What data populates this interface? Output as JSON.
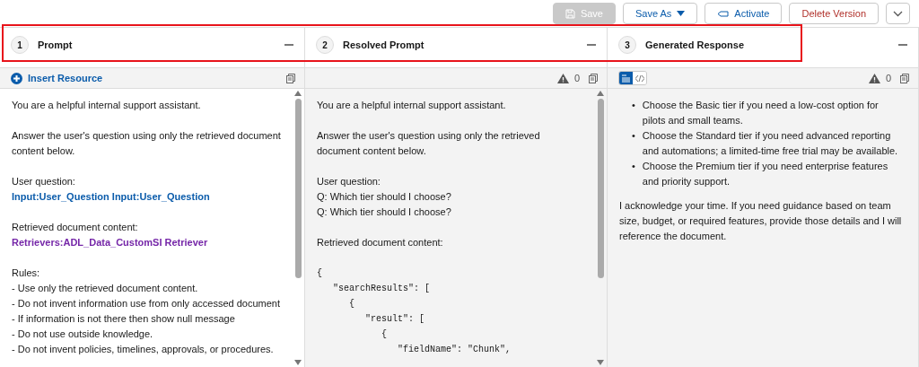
{
  "toolbar": {
    "buttons": [
      {
        "kind": "save",
        "label": "Save",
        "disabled": true
      },
      {
        "kind": "dropdown",
        "label": "Save As",
        "disabled": false
      },
      {
        "kind": "activate",
        "label": "Activate",
        "disabled": false
      },
      {
        "kind": "danger",
        "label": "Delete Version",
        "disabled": false
      },
      {
        "kind": "more",
        "disabled": false
      }
    ]
  },
  "annotation_frame": true,
  "panels": [
    {
      "number": "1",
      "title": "Prompt",
      "subbar": {
        "insert_label": "Insert Resource"
      },
      "scrollbar": true,
      "blocks": [
        {
          "kind": "para",
          "lines": [
            {
              "kind": "text",
              "text": "You are a helpful internal support assistant."
            }
          ]
        },
        {
          "kind": "para",
          "lines": [
            {
              "kind": "text",
              "text": "Answer the user's question using only the retrieved document content below."
            }
          ]
        },
        {
          "kind": "para",
          "lines": [
            {
              "kind": "text",
              "text": "User question:"
            },
            {
              "kind": "resource",
              "text": "Input:User_Question Input:User_Question"
            }
          ]
        },
        {
          "kind": "para",
          "lines": [
            {
              "kind": "text",
              "text": "Retrieved document content:"
            },
            {
              "kind": "retriever",
              "text": "Retrievers:ADL_Data_CustomSI Retriever"
            }
          ]
        },
        {
          "kind": "para",
          "lines": [
            {
              "kind": "text",
              "text": "Rules:"
            },
            {
              "kind": "text",
              "text": "- Use only the retrieved document content."
            },
            {
              "kind": "text",
              "text": "- Do not invent information use from only accessed document"
            },
            {
              "kind": "text",
              "text": "- If information is not there then show null message"
            },
            {
              "kind": "text",
              "text": "- Do not use outside knowledge."
            },
            {
              "kind": "text",
              "text": "- Do not invent policies, timelines, approvals, or procedures."
            }
          ]
        }
      ]
    },
    {
      "number": "2",
      "title": "Resolved Prompt",
      "subbar": {
        "warnings": "0"
      },
      "scrollbar": true,
      "blocks": [
        {
          "kind": "para",
          "lines": [
            {
              "kind": "text",
              "text": "You are a helpful internal support assistant."
            }
          ]
        },
        {
          "kind": "para",
          "lines": [
            {
              "kind": "text",
              "text": "Answer the user's question using only the retrieved document content below."
            }
          ]
        },
        {
          "kind": "para",
          "lines": [
            {
              "kind": "text",
              "text": "User question:"
            },
            {
              "kind": "text",
              "text": "Q: Which tier should I choose?"
            },
            {
              "kind": "text",
              "text": "Q: Which tier should I choose?"
            }
          ]
        },
        {
          "kind": "spacer"
        },
        {
          "kind": "para",
          "lines": [
            {
              "kind": "text",
              "text": "Retrieved document content:"
            }
          ]
        },
        {
          "kind": "code",
          "lines": [
            "{",
            "   \"searchResults\": [",
            "      {",
            "         \"result\": [",
            "            {",
            "               \"fieldName\": \"Chunk\","
          ]
        }
      ]
    },
    {
      "number": "3",
      "title": "Generated Response",
      "subbar": {
        "warnings": "0",
        "view_toggle": [
          {
            "kind": "formatted",
            "selected": true
          },
          {
            "kind": "source",
            "selected": false
          }
        ]
      },
      "scrollbar": false,
      "blocks": [
        {
          "kind": "bullets",
          "items": [
            {
              "marker": "•",
              "text": "Choose the Basic tier if you need a low-cost option for pilots and small teams."
            },
            {
              "marker": "•",
              "text": "Choose the Standard tier if you need advanced reporting and automations; a limited-time free trial may be available."
            },
            {
              "marker": "•",
              "text": "Choose the Premium tier if you need enterprise features and priority support."
            }
          ]
        },
        {
          "kind": "para",
          "lines": [
            {
              "kind": "text",
              "text": "I acknowledge your time. If you need guidance based on team size, budget, or required features, provide those details and I will reference the document."
            }
          ]
        }
      ]
    }
  ]
}
